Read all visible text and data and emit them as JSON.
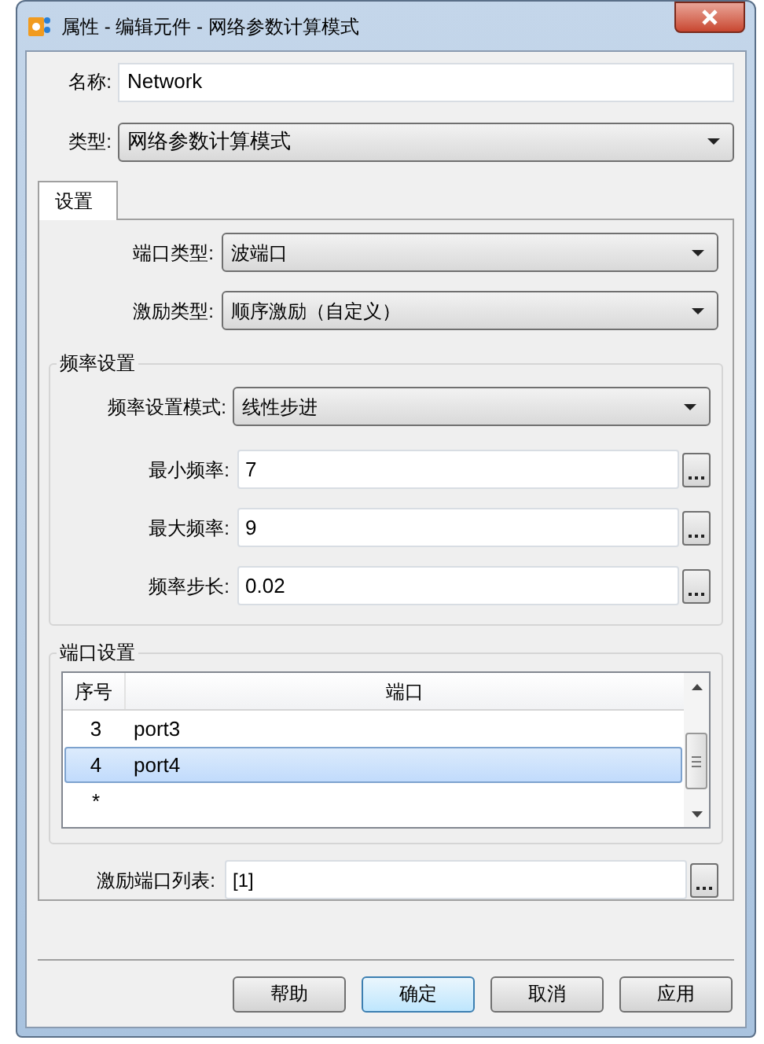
{
  "window": {
    "title": "属性 - 编辑元件 - 网络参数计算模式"
  },
  "name": {
    "label": "名称:",
    "value": "Network"
  },
  "type": {
    "label": "类型:",
    "value": "网络参数计算模式"
  },
  "tabs": [
    {
      "label": "设置",
      "selected": true
    }
  ],
  "top_selects": [
    {
      "label": "端口类型:",
      "value": "波端口"
    },
    {
      "label": "激励类型:",
      "value": "顺序激励（自定义）"
    }
  ],
  "frequency_group": {
    "title": "频率设置",
    "mode": {
      "label": "频率设置模式:",
      "value": "线性步进"
    },
    "fields": [
      {
        "label": "最小频率:",
        "value": "7"
      },
      {
        "label": "最大频率:",
        "value": "9"
      },
      {
        "label": "频率步长:",
        "value": "0.02"
      }
    ]
  },
  "port_group": {
    "title": "端口设置",
    "columns": [
      "序号",
      "端口"
    ],
    "rows": [
      {
        "index": "3",
        "port": "port3",
        "selected": false
      },
      {
        "index": "4",
        "port": "port4",
        "selected": true
      },
      {
        "index": "*",
        "selected": false
      }
    ]
  },
  "excitation_ports": {
    "label": "激励端口列表:",
    "value": "[1]"
  },
  "buttons": [
    {
      "label": "帮助",
      "default": false
    },
    {
      "label": "确定",
      "default": true
    },
    {
      "label": "取消",
      "default": false
    },
    {
      "label": "应用",
      "default": false
    }
  ]
}
